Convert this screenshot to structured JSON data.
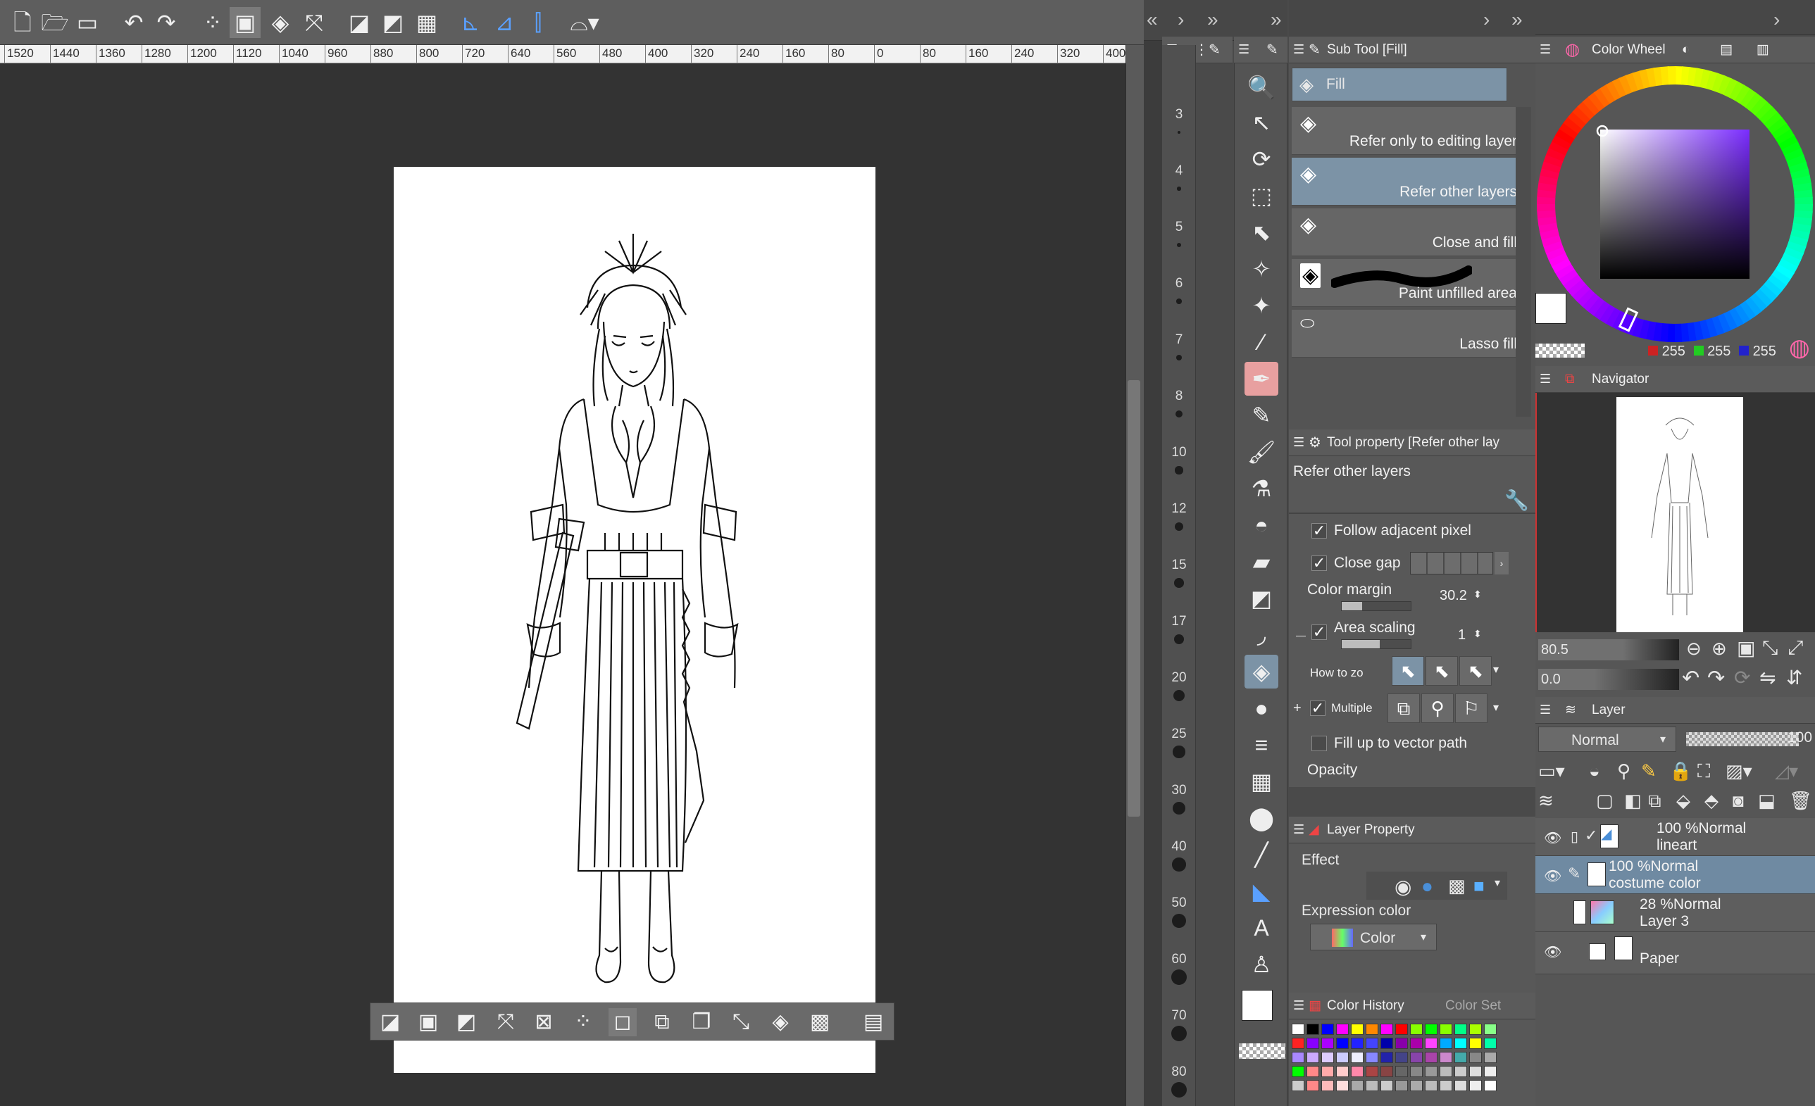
{
  "toolbar": {
    "icons": [
      "new-file-icon",
      "open-folder-icon",
      "save-icon",
      "undo-icon",
      "redo-icon",
      "clear-selection-icon",
      "select-all-icon",
      "fill-selection-icon",
      "transform-icon",
      "erase-selection-icon",
      "invert-icon",
      "show-grid-icon",
      "ruler-tool-icon",
      "perspective-ruler-icon",
      "symmetry-ruler-icon",
      "snap-menu-icon"
    ]
  },
  "ruler": {
    "labels": [
      "1520",
      "1440",
      "1360",
      "1280",
      "1200",
      "1120",
      "1040",
      "960",
      "880",
      "800",
      "720",
      "640",
      "560",
      "480",
      "400",
      "320",
      "240",
      "160",
      "80",
      "0",
      "80",
      "160",
      "240",
      "320",
      "400"
    ]
  },
  "vertical_ruler": {
    "labels": [
      "3",
      "4",
      "5",
      "6",
      "7",
      "8",
      "10",
      "12",
      "15",
      "17",
      "20",
      "25",
      "30",
      "40",
      "50",
      "60",
      "70",
      "80"
    ]
  },
  "sub_tool": {
    "title": "Sub Tool [Fill]",
    "group_label": "Fill",
    "items": [
      {
        "label": "Refer only to editing layer",
        "selected": false
      },
      {
        "label": "Refer other layers",
        "selected": true
      },
      {
        "label": "Close and fill",
        "selected": false
      },
      {
        "label": "Paint unfilled area",
        "selected": false
      },
      {
        "label": "Lasso fill",
        "selected": false
      }
    ]
  },
  "tool_property": {
    "title": "Tool property [Refer other lay",
    "tool_name": "Refer other layers",
    "follow_adjacent": "Follow adjacent pixel",
    "close_gap": "Close gap",
    "color_margin_label": "Color margin",
    "color_margin_value": "30.2",
    "color_margin_fraction": 0.3,
    "area_scaling_label": "Area scaling",
    "area_scaling_value": "1",
    "area_scaling_fraction": 0.55,
    "how_to_zoom": "How to zo",
    "multiple": "Multiple",
    "fill_vector": "Fill up to vector path",
    "opacity": "Opacity"
  },
  "layer_property": {
    "title": "Layer Property",
    "effect_label": "Effect",
    "expression_label": "Expression color",
    "expression_value": "Color"
  },
  "color_history": {
    "tab1": "Color History",
    "tab2": "Color Set",
    "rows": [
      [
        "#ffffff",
        "#000000",
        "#0000ff",
        "#ff00ff",
        "#ffff00",
        "#ff8800",
        "#ff00ff",
        "#ff0000",
        "#88ff00",
        "#00ff00",
        "#88ff00",
        "#00ff88",
        "#aaff00",
        "#88ff88"
      ],
      [
        "#ff2222",
        "#8800ff",
        "#aa00ff",
        "#0000ff",
        "#2222ff",
        "#4444ff",
        "#0000aa",
        "#8800aa",
        "#aa00aa",
        "#ff44ff",
        "#00aaff",
        "#00ffff",
        "#ffff00",
        "#00ffaa"
      ],
      [
        "#aa88ff",
        "#ccaaff",
        "#ddccff",
        "#ccccff",
        "#eeeeff",
        "#8888ff",
        "#2222aa",
        "#444488",
        "#8844aa",
        "#aa44aa",
        "#cc88cc",
        "#44aaaa",
        "#888888",
        "#aaaaaa"
      ],
      [
        "#00ff00",
        "#ff8888",
        "#ffaaaa",
        "#ffcccc",
        "#ff88aa",
        "#aa4444",
        "#884444",
        "#666666",
        "#888888",
        "#999999",
        "#bbbbbb",
        "#cccccc",
        "#dddddd",
        "#eeeeee"
      ],
      [
        "#cccccc",
        "#ff8888",
        "#ffbbbb",
        "#ffdddd",
        "#aaaaaa",
        "#bbbbbb",
        "#cccccc",
        "#999999",
        "#aaaaaa",
        "#bbbbbb",
        "#cccccc",
        "#dddddd",
        "#eeeeee",
        "#ffffff"
      ]
    ]
  },
  "color_wheel": {
    "title": "Color Wheel",
    "r": "255",
    "g": "255",
    "b": "255"
  },
  "navigator": {
    "title": "Navigator",
    "zoom": "80.5",
    "rotation": "0.0"
  },
  "layers": {
    "title": "Layer",
    "blend_mode": "Normal",
    "opacity": "100",
    "items": [
      {
        "pct": "100 %Normal",
        "name": "lineart",
        "visible": true,
        "selected": false
      },
      {
        "pct": "100 %Normal",
        "name": "costume color",
        "visible": true,
        "selected": true
      },
      {
        "pct": "28 %Normal",
        "name": "Layer 3",
        "visible": false,
        "selected": false
      },
      {
        "pct": "",
        "name": "Paper",
        "visible": true,
        "selected": false
      }
    ]
  },
  "floating_bar": {
    "icons": [
      "deselect-icon",
      "select-icon",
      "fill-icon",
      "crop-icon",
      "expand-icon",
      "scatter-icon",
      "transform-icon",
      "copy-icon",
      "paste-icon",
      "scale-icon",
      "bucket-icon",
      "checker-icon",
      "ruler-icon"
    ]
  },
  "colors": {
    "accent": "#7c93a6",
    "canvas_bg": "#333333",
    "panel_bg": "#565656"
  }
}
